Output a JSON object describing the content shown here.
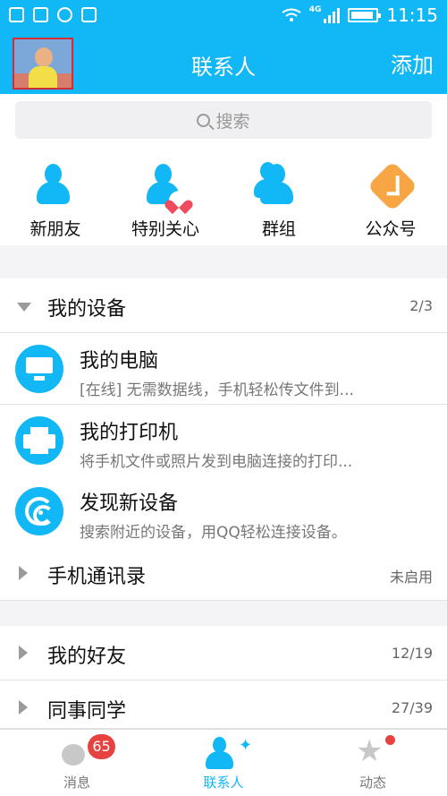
{
  "status": {
    "time": "11:15",
    "network": "4G",
    "icons": [
      "image-icon",
      "sync-icon",
      "sim-icon",
      "wifi-icon",
      "signal-icon",
      "battery-icon"
    ]
  },
  "header": {
    "title": "联系人",
    "add_label": "添加"
  },
  "search": {
    "placeholder": "搜索"
  },
  "quick_actions": [
    {
      "label": "新朋友",
      "icon": "new-friend-icon"
    },
    {
      "label": "特别关心",
      "icon": "special-care-icon"
    },
    {
      "label": "群组",
      "icon": "group-icon"
    },
    {
      "label": "公众号",
      "icon": "official-account-icon"
    }
  ],
  "groups": {
    "devices": {
      "title": "我的设备",
      "count": "2/3"
    },
    "phone_contacts": {
      "title": "手机通讯录",
      "count": "未启用"
    },
    "friends": {
      "title": "我的好友",
      "count": "12/19"
    },
    "colleagues": {
      "title": "同事同学",
      "count": "27/39"
    }
  },
  "devices": [
    {
      "title": "我的电脑",
      "subtitle": "[在线] 无需数据线，手机轻松传文件到..."
    },
    {
      "title": "我的打印机",
      "subtitle": "将手机文件或照片发到电脑连接的打印..."
    },
    {
      "title": "发现新设备",
      "subtitle": "搜索附近的设备，用QQ轻松连接设备。"
    }
  ],
  "tabs": [
    {
      "label": "消息",
      "badge": "65"
    },
    {
      "label": "联系人"
    },
    {
      "label": "动态"
    }
  ],
  "colors": {
    "brand_blue": "#12b7f5",
    "alert_red": "#e64340",
    "accent_orange": "#f8a643"
  }
}
